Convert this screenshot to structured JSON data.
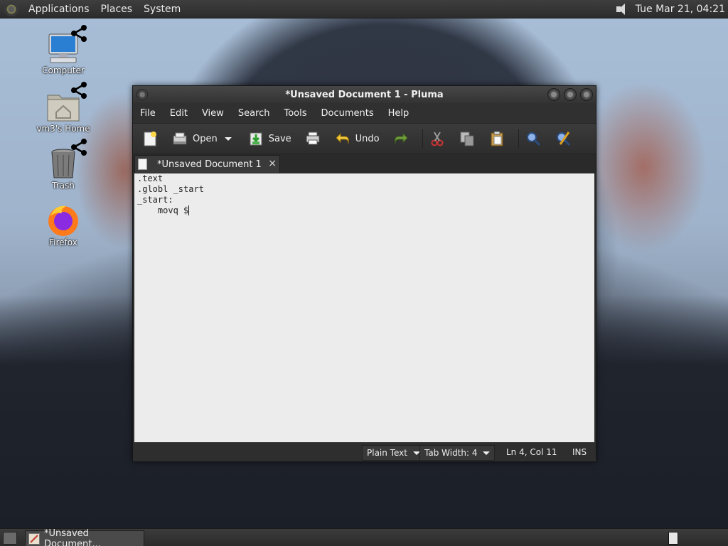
{
  "top_panel": {
    "menus": [
      "Applications",
      "Places",
      "System"
    ],
    "clock": "Tue Mar 21, 04:21"
  },
  "desktop_icons": [
    {
      "label": "Computer"
    },
    {
      "label": "vm3's Home"
    },
    {
      "label": "Trash"
    },
    {
      "label": "Firefox"
    }
  ],
  "window": {
    "title": "*Unsaved Document 1 - Pluma",
    "menu": [
      "File",
      "Edit",
      "View",
      "Search",
      "Tools",
      "Documents",
      "Help"
    ],
    "toolbar": {
      "open_label": "Open",
      "save_label": "Save",
      "undo_label": "Undo"
    },
    "tab_label": "*Unsaved Document 1",
    "tab_close": "×",
    "editor_lines": [
      ".text",
      ".globl _start",
      "_start:",
      "    movq $"
    ],
    "status": {
      "language": "Plain Text",
      "tab_width": "Tab Width:  4",
      "position": "Ln 4, Col 11",
      "mode": "INS"
    }
  },
  "taskbar": {
    "task_label": "*Unsaved Document..."
  },
  "colors": {
    "panel": "#2c2c2c",
    "editor_bg": "#ececec",
    "window_bg": "#2e2e2e"
  }
}
